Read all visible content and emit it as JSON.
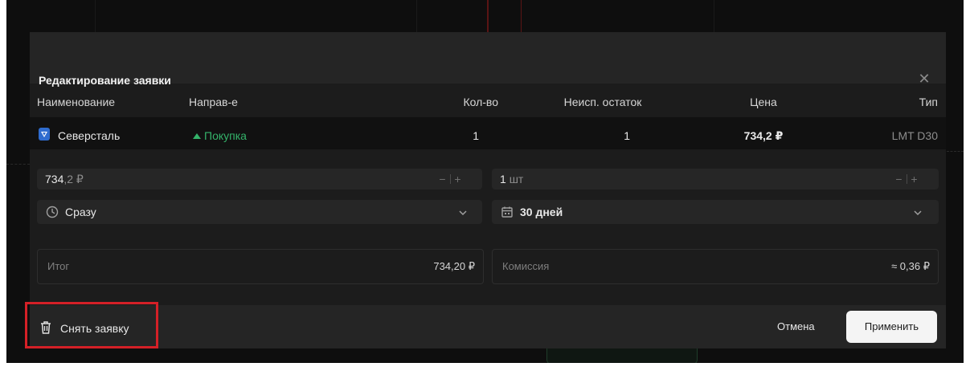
{
  "dialog": {
    "title": "Редактирование заявки",
    "close_icon": "close-icon"
  },
  "table": {
    "headers": [
      "Наименование",
      "Направ-е",
      "Кол-во",
      "Неисп. остаток",
      "Цена",
      "Тип"
    ],
    "row": {
      "name": "Северсталь",
      "direction": "Покупка",
      "quantity": "1",
      "remaining": "1",
      "price": "734,2 ₽",
      "type": "LMT D30"
    }
  },
  "form": {
    "price_input": {
      "value_main": "734",
      "value_fraction": ",2 ₽"
    },
    "quantity_input": {
      "value_main": "1",
      "value_unit": "шт"
    },
    "execution_select": {
      "value": "Сразу",
      "icon": "clock-icon"
    },
    "duration_select": {
      "value": "30 дней",
      "icon": "calendar-icon"
    },
    "stepper": {
      "minus": "−",
      "plus": "+"
    }
  },
  "summary": {
    "total_label": "Итог",
    "total_value": "734,20 ₽",
    "commission_label": "Комиссия",
    "commission_value": "≈ 0,36 ₽"
  },
  "footer": {
    "cancel_order_label": "Снять заявку",
    "cancel_label": "Отмена",
    "apply_label": "Применить"
  },
  "colors": {
    "buy": "#34b36a",
    "highlight": "#d42027",
    "modal_bg": "#1c1c1c"
  }
}
